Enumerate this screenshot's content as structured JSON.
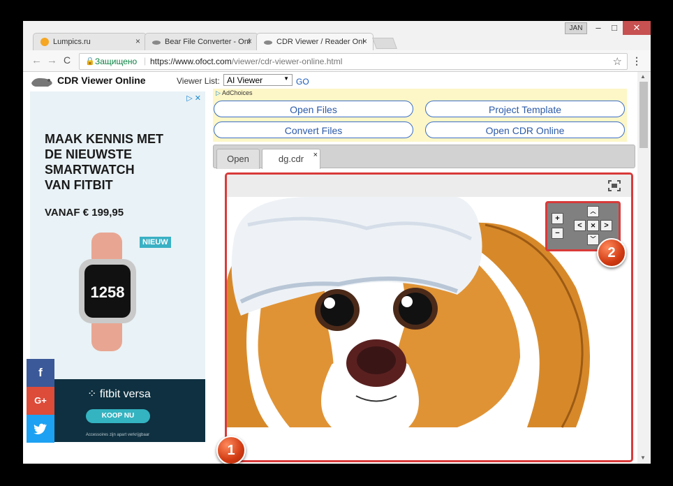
{
  "browser": {
    "tabs": [
      {
        "label": "Lumpics.ru",
        "close": "×"
      },
      {
        "label": "Bear File Converter - Onl",
        "close": "×"
      },
      {
        "label": "CDR Viewer / Reader Onl",
        "close": "×"
      }
    ],
    "user_badge": "JAN",
    "window_controls": {
      "minimize": "–",
      "maximize": "□",
      "close": "✕"
    },
    "secure_label": "Защищено",
    "url_host": "https://www.ofoct.com",
    "url_path": "/viewer/cdr-viewer-online.html",
    "url_separator": "|",
    "star": "☆",
    "menu": "⋮",
    "nav": {
      "back": "←",
      "forward": "→",
      "reload": "C"
    }
  },
  "site": {
    "brand": "CDR Viewer Online",
    "viewer_list_label": "Viewer List:",
    "viewer_select_value": "AI Viewer",
    "go_label": "GO",
    "adchoices": "AdChoices",
    "buttons": {
      "open_files": "Open Files",
      "project_template": "Project Template",
      "convert_files": "Convert Files",
      "open_cdr_online": "Open CDR Online"
    },
    "viewer_tabs": [
      {
        "label": "Open"
      },
      {
        "label": "dg.cdr",
        "close": "×"
      }
    ]
  },
  "ad": {
    "headline_lines": [
      "MAAK KENNIS MET",
      "DE NIEUWSTE",
      "SMARTWATCH",
      "VAN FITBIT"
    ],
    "price": "VANAF € 199,95",
    "badge": "NIEUW",
    "watch_time": "1258",
    "brand": "fitbit versa",
    "cta": "KOOP NU",
    "small_print": "Accessoires zijn apart verkrijgbaar",
    "adchoices_icon": "▷ ✕"
  },
  "social": [
    {
      "icon": "facebook-icon",
      "glyph": "f",
      "color": "#3b5998"
    },
    {
      "icon": "google-plus-icon",
      "glyph": "G+",
      "color": "#dd4b39"
    },
    {
      "icon": "twitter-icon",
      "glyph": "🐦",
      "color": "#1da1f2"
    }
  ],
  "nav_panel": {
    "zoom_in": "+",
    "zoom_out": "−",
    "up": "︿",
    "down": "﹀",
    "left": "<",
    "right": ">",
    "reset": "✕"
  },
  "annotations": [
    "1",
    "2"
  ],
  "colors": {
    "highlight": "#d93a3a",
    "button_border": "#3a6ec6",
    "ad_bar": "#fdf6c7"
  }
}
